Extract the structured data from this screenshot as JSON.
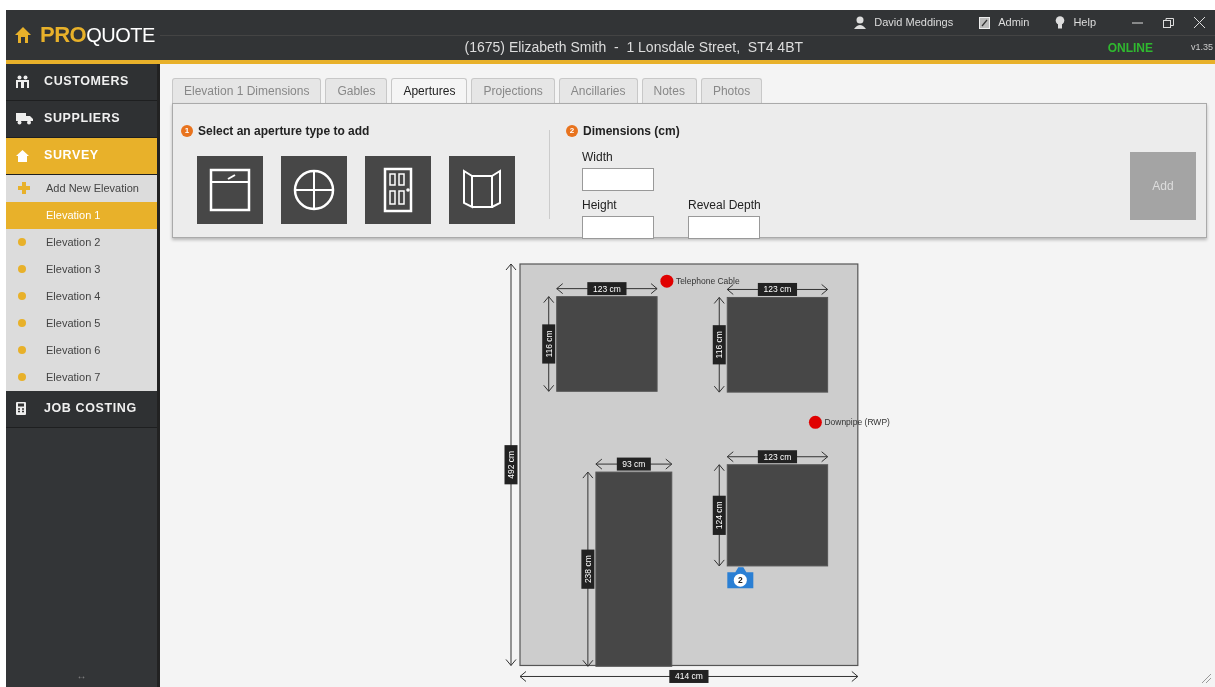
{
  "header": {
    "logo": "**PRO**QUOTE",
    "title": "(1675) Elizabeth Smith  -  1 Lonsdale Street,  ST4 4BT",
    "user": "David Meddings",
    "admin": "Admin",
    "help": "Help",
    "status": "ONLINE",
    "version": "v1.35"
  },
  "sidebar": {
    "items": [
      {
        "kind": "section",
        "label": "CUSTOMERS",
        "selected": false
      },
      {
        "kind": "section",
        "label": "SUPPLIERS",
        "selected": false
      },
      {
        "kind": "section",
        "label": "SURVEY",
        "selected": true
      },
      {
        "kind": "add",
        "label": "Add New Elevation",
        "selected": false
      },
      {
        "kind": "elevation",
        "label": "Elevation 1",
        "selected": true
      },
      {
        "kind": "elevation",
        "label": "Elevation 2",
        "selected": false
      },
      {
        "kind": "elevation",
        "label": "Elevation 3",
        "selected": false
      },
      {
        "kind": "elevation",
        "label": "Elevation 4",
        "selected": false
      },
      {
        "kind": "elevation",
        "label": "Elevation 5",
        "selected": false
      },
      {
        "kind": "elevation",
        "label": "Elevation 6",
        "selected": false
      },
      {
        "kind": "elevation",
        "label": "Elevation 7",
        "selected": false
      },
      {
        "kind": "section",
        "label": "JOB COSTING",
        "selected": false
      }
    ],
    "footer": "↔"
  },
  "tabs": [
    {
      "label": "Elevation 1 Dimensions",
      "selected": false
    },
    {
      "label": "Gables",
      "selected": false
    },
    {
      "label": "Apertures",
      "selected": true
    },
    {
      "label": "Projections",
      "selected": false
    },
    {
      "label": "Ancillaries",
      "selected": false
    },
    {
      "label": "Notes",
      "selected": false
    },
    {
      "label": "Photos",
      "selected": false
    }
  ],
  "panel": {
    "step_1": {
      "number": "1",
      "title": "Select an aperture type to add"
    },
    "step_2": {
      "number": "2",
      "title": "Dimensions (cm)"
    },
    "fields": [
      {
        "label": "Width"
      },
      {
        "label": "Height"
      },
      {
        "label": "Reveal Depth"
      }
    ],
    "add_button": {
      "label": "Add",
      "disabled": true
    }
  },
  "elevation": {
    "width_label": "414 cm",
    "height_label": "492 cm",
    "apertures": [
      {
        "width_label": "123 cm",
        "height_label": "116 cm"
      },
      {
        "width_label": "123 cm",
        "height_label": "116 cm"
      },
      {
        "width_label": "93 cm",
        "height_label": "238 cm"
      },
      {
        "width_label": "123 cm",
        "height_label": "124 cm"
      }
    ],
    "markers": [
      {
        "label": "Telephone Cable"
      },
      {
        "label": "Downpipe (RWP)"
      }
    ],
    "photo_pins": [
      {
        "number": "2"
      }
    ]
  }
}
